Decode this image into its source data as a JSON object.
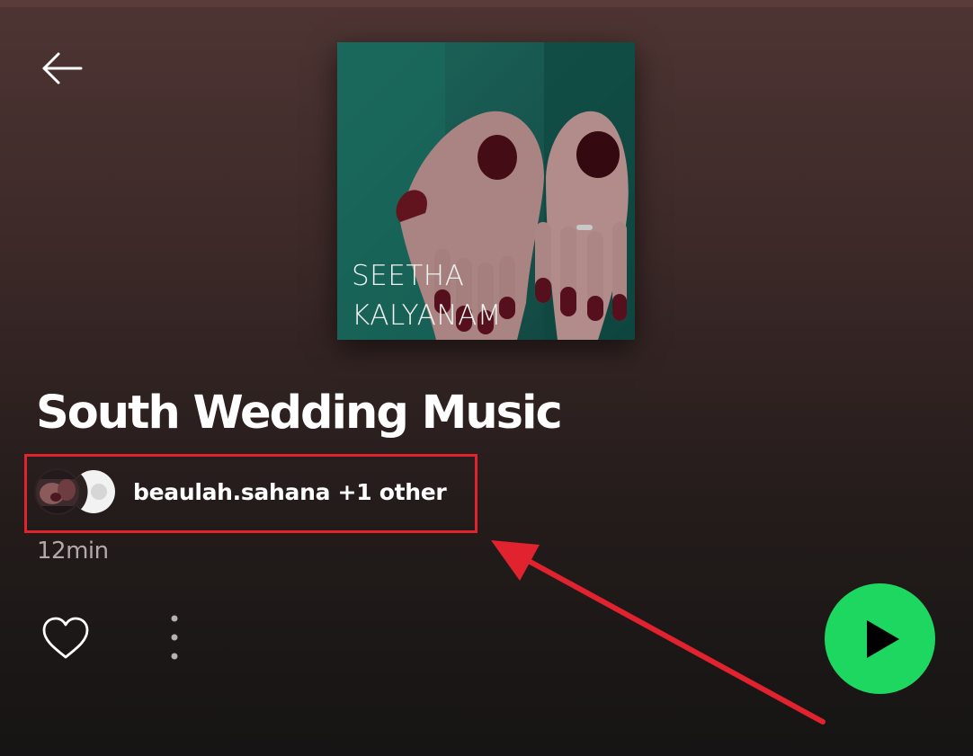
{
  "nav": {
    "back_icon": "arrow-left-icon"
  },
  "cover": {
    "line1": "SEETHA",
    "line2": "KALYANAM"
  },
  "playlist": {
    "title": "South Wedding Music",
    "owners": "beaulah.sahana +1 other",
    "duration": "12min"
  },
  "actions": {
    "like_icon": "heart-outline-icon",
    "more_icon": "more-vertical-icon",
    "play_icon": "play-icon"
  },
  "annotation": {
    "color": "#e0232e"
  },
  "colors": {
    "accent": "#1ed760",
    "text_secondary": "#b3a9a7"
  }
}
